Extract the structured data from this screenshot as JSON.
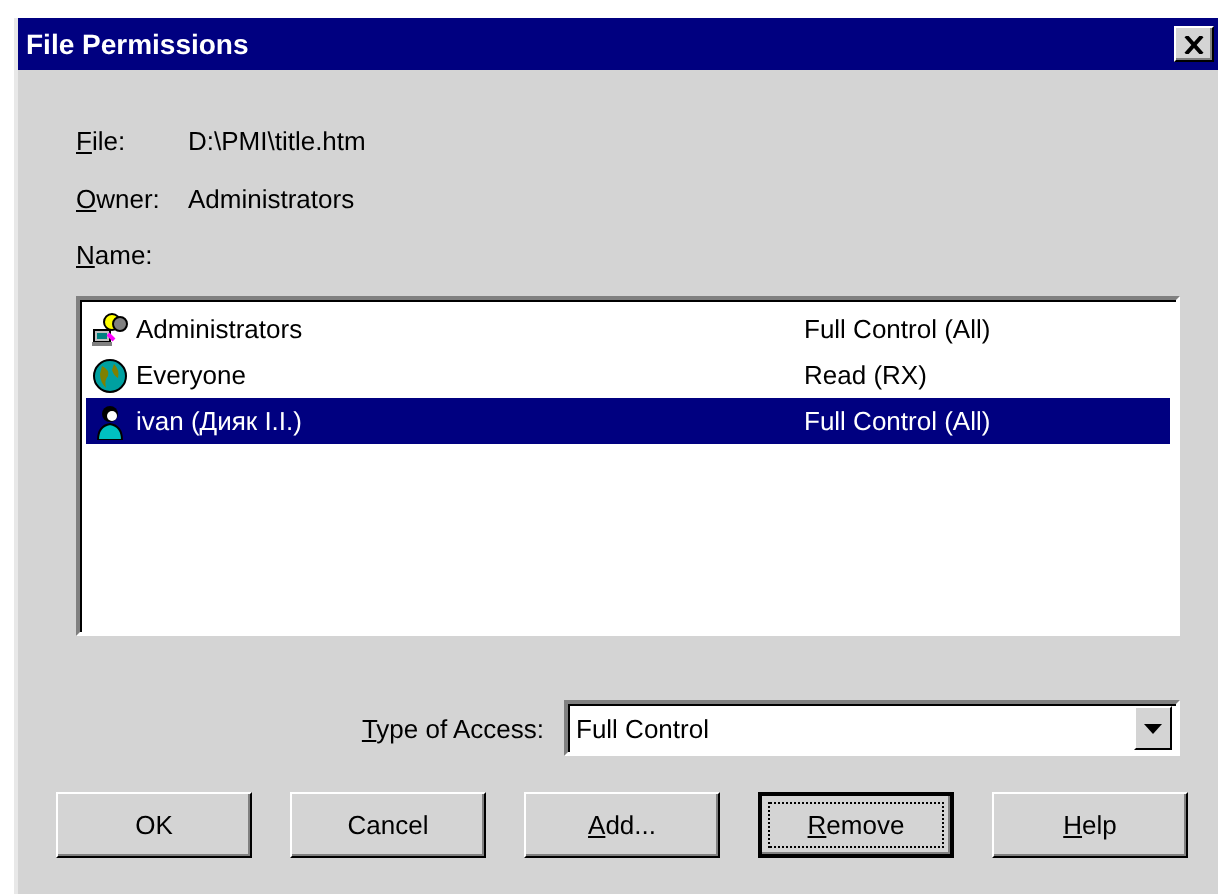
{
  "window": {
    "title": "File Permissions"
  },
  "info": [
    {
      "label": {
        "key": "F",
        "after": "ile:"
      },
      "value": "D:\\PMI\\title.htm"
    },
    {
      "label": {
        "key": "O",
        "after": "wner:"
      },
      "value": "Administrators"
    }
  ],
  "name_label": {
    "key": "N",
    "after": "ame:"
  },
  "entries": [
    {
      "kind": "group-admin",
      "name": "Administrators",
      "access": "Full Control (All)",
      "selected": false
    },
    {
      "kind": "group-world",
      "name": "Everyone",
      "access": "Read (RX)",
      "selected": false
    },
    {
      "kind": "user",
      "name": "ivan (Дияк I.I.)",
      "access": "Full Control (All)",
      "selected": true
    }
  ],
  "type_of_access": {
    "label": {
      "key": "T",
      "after": "ype of Access:"
    },
    "value": "Full Control"
  },
  "buttons": [
    {
      "label": {
        "before": "OK"
      },
      "focused": false
    },
    {
      "label": {
        "before": "Cancel"
      },
      "focused": false
    },
    {
      "label": {
        "key": "A",
        "after": "dd..."
      },
      "focused": false
    },
    {
      "label": {
        "key": "R",
        "after": "emove"
      },
      "focused": true
    },
    {
      "label": {
        "key": "H",
        "after": "elp"
      },
      "focused": false
    }
  ]
}
